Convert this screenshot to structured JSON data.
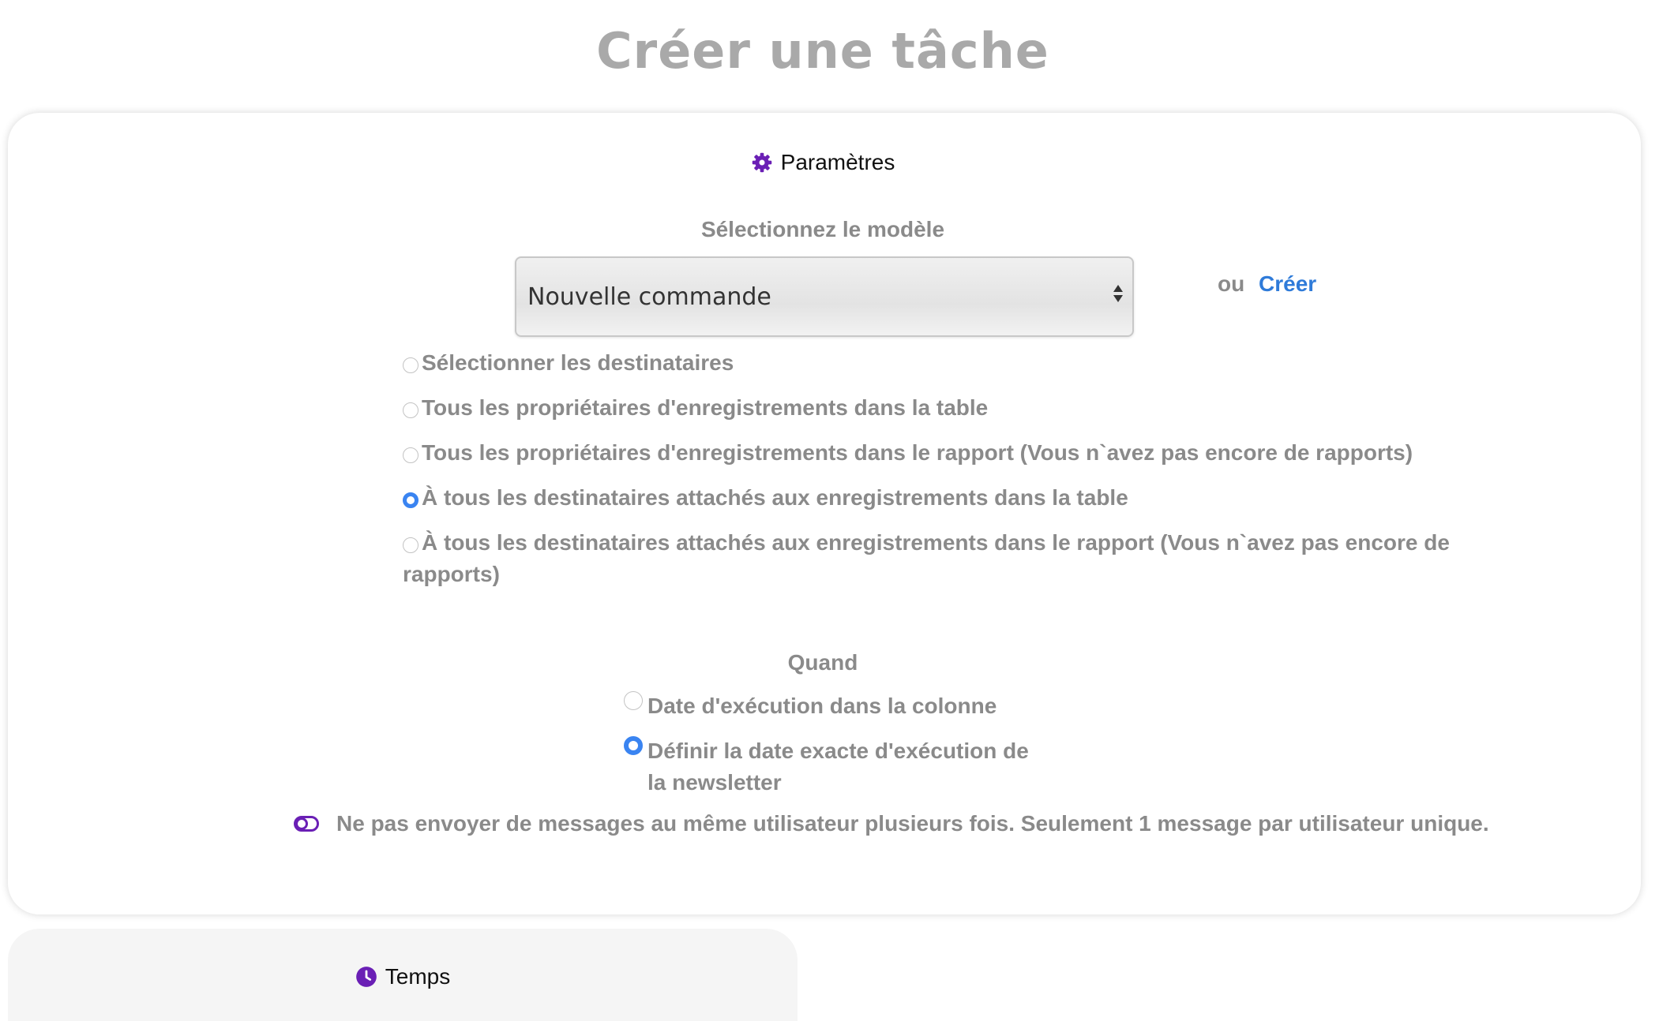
{
  "page": {
    "title": "Créer une tâche"
  },
  "colors": {
    "accent": "#6a1fb5",
    "link": "#2f7bd9",
    "radio_selected": "#3a84f1",
    "muted_text": "#8a8a8a"
  },
  "parameters": {
    "header": "Paramètres",
    "header_icon": "gear-icon",
    "template_label": "Sélectionnez le modèle",
    "template_selected": "Nouvelle commande",
    "or_text": "ou",
    "create_link": "Créer",
    "recipients": [
      {
        "label": "Sélectionner les destinataires",
        "selected": false
      },
      {
        "label": "Tous les propriétaires d'enregistrements dans la table",
        "selected": false
      },
      {
        "label": "Tous les propriétaires d'enregistrements dans le rapport (Vous n`avez pas encore de rapports)",
        "selected": false
      },
      {
        "label": "À tous les destinataires attachés aux enregistrements dans la table",
        "selected": true
      },
      {
        "label": "À tous les destinataires attachés aux enregistrements dans le rapport (Vous n`avez pas encore de rapports)",
        "selected": false
      }
    ],
    "when_label": "Quand",
    "when_options": [
      {
        "label": "Date d'exécution dans la colonne",
        "selected": false
      },
      {
        "label": "Définir la date exacte d'exécution de la newsletter",
        "selected": true
      }
    ],
    "unique_toggle_label": "Ne pas envoyer de messages au même utilisateur plusieurs fois. Seulement 1 message par utilisateur unique.",
    "unique_toggle_icon": "toggle-icon"
  },
  "time": {
    "header": "Temps",
    "header_icon": "clock-icon"
  }
}
